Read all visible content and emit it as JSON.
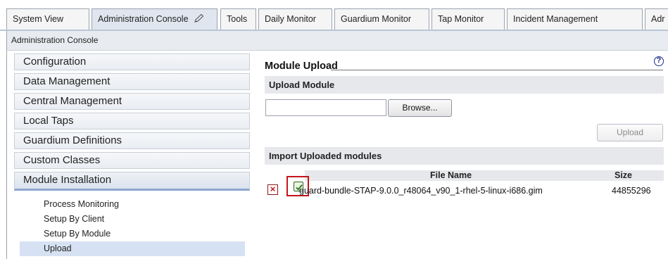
{
  "tabs": [
    {
      "label": "System View",
      "active": false
    },
    {
      "label": "Administration Console",
      "active": true,
      "icon": "pencil-icon"
    },
    {
      "label": "Tools",
      "active": false
    },
    {
      "label": "Daily Monitor",
      "active": false
    },
    {
      "label": "Guardium Monitor",
      "active": false
    },
    {
      "label": "Tap Monitor",
      "active": false
    },
    {
      "label": "Incident Management",
      "active": false
    },
    {
      "label": "Adr",
      "active": false
    }
  ],
  "breadcrumb": "Administration Console",
  "sidebar": {
    "items": [
      {
        "label": "Configuration"
      },
      {
        "label": "Data Management"
      },
      {
        "label": "Central Management"
      },
      {
        "label": "Local Taps"
      },
      {
        "label": "Guardium Definitions"
      },
      {
        "label": "Custom Classes"
      },
      {
        "label": "Module Installation",
        "active": true
      }
    ],
    "subitems": [
      {
        "label": "Process Monitoring"
      },
      {
        "label": "Setup By Client"
      },
      {
        "label": "Setup By Module"
      },
      {
        "label": "Upload",
        "active": true
      }
    ]
  },
  "main": {
    "title": "Module Upload",
    "help_glyph": "?",
    "upload_section": {
      "heading": "Upload Module",
      "file_value": "",
      "browse_label": "Browse...",
      "upload_label": "Upload"
    },
    "import_section": {
      "heading": "Import Uploaded modules",
      "columns": [
        "File Name",
        "Size"
      ],
      "rows": [
        {
          "file_name": "guard-bundle-STAP-9.0.0_r48064_v90_1-rhel-5-linux-i686.gim",
          "size": "44855296"
        }
      ]
    }
  },
  "colors": {
    "highlight_border": "#c4151c",
    "active_tab": "#dfe6ef",
    "active_sidebar_underline": "#8fa7d2",
    "delete_icon": "#c8101a"
  }
}
